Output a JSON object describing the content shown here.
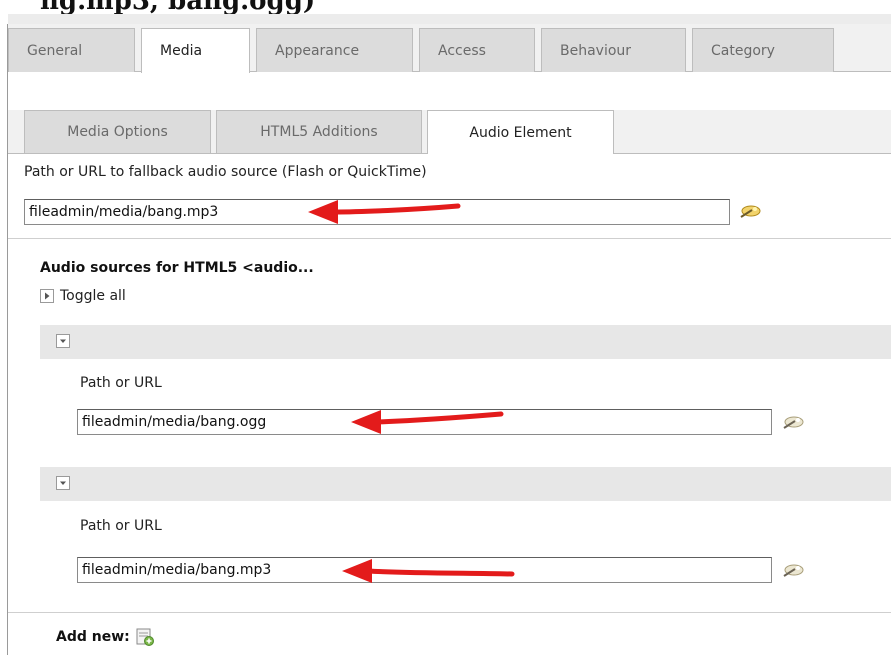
{
  "heading": "ng.mp3, bang.ogg)",
  "tabs": [
    {
      "label": "General",
      "active": false
    },
    {
      "label": "Media",
      "active": true
    },
    {
      "label": "Appearance",
      "active": false
    },
    {
      "label": "Access",
      "active": false
    },
    {
      "label": "Behaviour",
      "active": false
    },
    {
      "label": "Category",
      "active": false
    }
  ],
  "subtabs": [
    {
      "label": "Media Options",
      "active": false
    },
    {
      "label": "HTML5 Additions",
      "active": false
    },
    {
      "label": "Audio Element",
      "active": true
    }
  ],
  "fallback": {
    "label": "Path or URL to fallback audio source (Flash or QuickTime)",
    "value": "fileadmin/media/bang.mp3"
  },
  "sources": {
    "title": "Audio sources for HTML5 <audio...",
    "toggle_all": "Toggle all",
    "items": [
      {
        "label": "Path or URL",
        "value": "fileadmin/media/bang.ogg"
      },
      {
        "label": "Path or URL",
        "value": "fileadmin/media/bang.mp3"
      }
    ],
    "add_new": "Add new:"
  },
  "colors": {
    "arrow": "#e31b1b",
    "accent": "#7ab648"
  },
  "icons": {
    "wizard": "wizard-wand-icon",
    "add": "add-record-icon",
    "toggle": "expand-toggle-icon"
  }
}
